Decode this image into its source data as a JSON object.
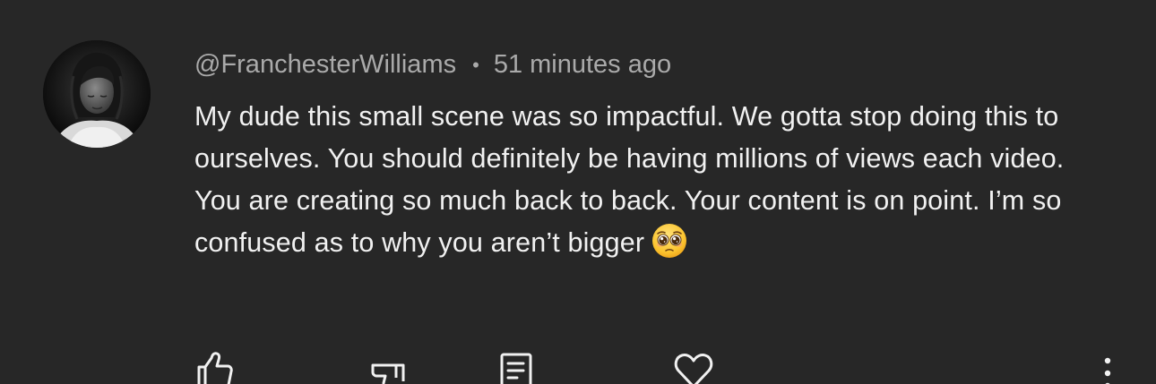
{
  "comment": {
    "author": "@FranchesterWilliams",
    "separator": "•",
    "timestamp": "51 minutes ago",
    "text": "My dude this small scene was so impactful. We gotta stop doing this to ourselves. You should definitely be having millions of views each video. You are creating so much back to back. Your content is on point. I’m so confused as to why you aren’t bigger",
    "emoji": "pleading-face-emoji"
  },
  "actions": {
    "icons": [
      "thumbs-up-icon",
      "thumbs-down-icon",
      "reply-icon",
      "heart-icon",
      "more-options-icon"
    ]
  },
  "colors": {
    "background": "#272727",
    "text": "#f1f1f1",
    "secondary_text": "#aaaaaa",
    "icon": "#f1f1f1"
  }
}
